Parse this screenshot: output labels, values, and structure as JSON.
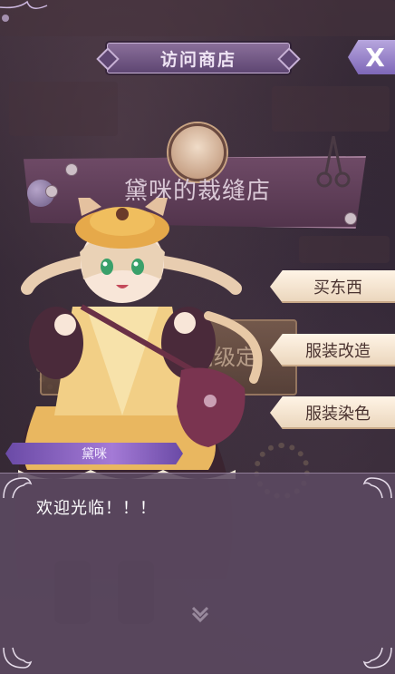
{
  "header": {
    "title": "访问商店"
  },
  "close_button": {
    "label": "X"
  },
  "shop": {
    "name": "黛咪的裁缝店",
    "counter_sign": "高级定"
  },
  "menu": [
    {
      "label": "买东西"
    },
    {
      "label": "服装改造"
    },
    {
      "label": "服装染色"
    }
  ],
  "dialog": {
    "speaker": "黛咪",
    "text": "欢迎光临！！！"
  },
  "colors": {
    "accent_purple": "#7e67b8",
    "menu_cream": "#f5e7d4",
    "dialog_bg": "#5c4a62"
  }
}
